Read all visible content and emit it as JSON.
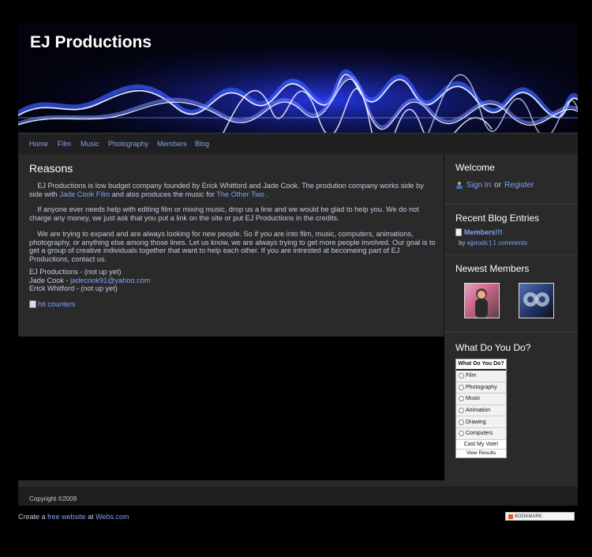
{
  "site": {
    "title": "EJ Productions"
  },
  "nav": [
    "Home",
    "Film",
    "Music",
    "Photography",
    "Members",
    "Blog"
  ],
  "main": {
    "heading": "Reasons",
    "p1": {
      "pre": "    EJ Productions is low budget company founded by Erick Whitford and Jade Cook. The prodution company works side by side with ",
      "link1": "Jade Cook Film",
      "mid": " and also produces the music for ",
      "link2": "The Other Two",
      "post": " ."
    },
    "p2": "    If anyone ever needs help with editing film or mixing music, drop us a line and we would be glad to help you. We do not charge any money, we just ask that you put a link on the site or put EJ Productions in the credits.",
    "p3": "    We are trying to expand and are always looking for new people. So if you are into film, music, computers, animations, photography, or anything else among those lines. Let us know, we are always trying to get more people involved. Our goal is to get a group of creative individuals together that want to help each other. If you are intrested at becomeing part of EJ Productions, contact us.",
    "contacts": {
      "line1": "EJ Productions - (not up yet)",
      "line2_pre": "Jade Cook - ",
      "line2_email": "jadecook91@yahoo.com",
      "line3": "Erick Whitford - (not up yet)"
    },
    "hit_counter_alt": "hit counters"
  },
  "sidebar": {
    "welcome": {
      "title": "Welcome",
      "signin": "Sign In",
      "or": "or",
      "register": "Register"
    },
    "blog": {
      "title": "Recent Blog Entries",
      "entry": "Members!!!",
      "by": "by",
      "author": "ejprods",
      "sep": "|",
      "comments": "1 comments"
    },
    "members": {
      "title": "Newest Members"
    },
    "poll": {
      "title": "What Do You Do?",
      "box_title": "What Do You Do?",
      "options": [
        "Film",
        "Photography",
        "Music",
        "Animation",
        "Drawing",
        "Computers"
      ],
      "vote": "Cast My Vote!",
      "results": "View Results"
    }
  },
  "footer": {
    "copyright": "Copyright ©2009"
  },
  "bottom": {
    "create": "Create a",
    "free_site": "free website",
    "at": "at",
    "webs": "Webs.com",
    "bookmark": "BOOKMARK"
  }
}
